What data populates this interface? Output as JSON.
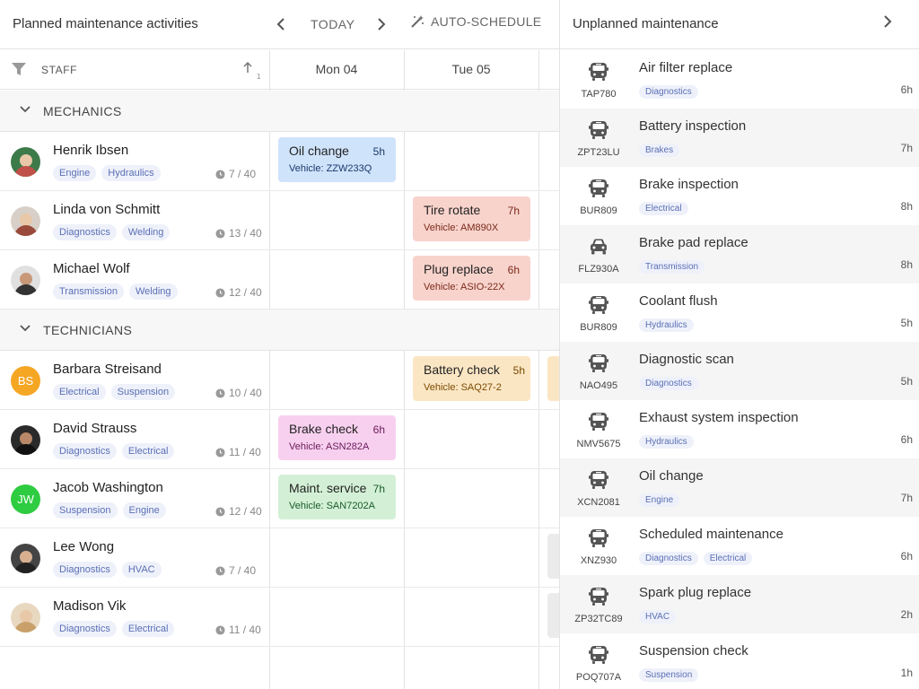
{
  "header": {
    "title": "Planned maintenance activities",
    "today_label": "TODAY",
    "autoschedule_label": "AUTO-SCHEDULE"
  },
  "columns": {
    "staff_label": "STAFF",
    "sort_count": "1",
    "days": [
      "Mon 04",
      "Tue 05"
    ]
  },
  "groups": {
    "mechanics": "MECHANICS",
    "technicians": "TECHNICIANS"
  },
  "staff": [
    {
      "name": "Henrik Ibsen",
      "tags": [
        "Engine",
        "Hydraulics"
      ],
      "hours": "7 / 40",
      "initials": "",
      "avatar_color": "#3d7a4a"
    },
    {
      "name": "Linda von Schmitt",
      "tags": [
        "Diagnostics",
        "Welding"
      ],
      "hours": "13 / 40",
      "initials": "",
      "avatar_color": "#9a4a3a"
    },
    {
      "name": "Michael Wolf",
      "tags": [
        "Transmission",
        "Welding"
      ],
      "hours": "12 / 40",
      "initials": "",
      "avatar_color": "#333333"
    },
    {
      "name": "Barbara Streisand",
      "tags": [
        "Electrical",
        "Suspension"
      ],
      "hours": "10 / 40",
      "initials": "BS",
      "avatar_color": "#f5a623"
    },
    {
      "name": "David Strauss",
      "tags": [
        "Diagnostics",
        "Electrical"
      ],
      "hours": "11 / 40",
      "initials": "",
      "avatar_color": "#2a2a2a"
    },
    {
      "name": "Jacob Washington",
      "tags": [
        "Suspension",
        "Engine"
      ],
      "hours": "12 / 40",
      "initials": "JW",
      "avatar_color": "#2ecc40"
    },
    {
      "name": "Lee Wong",
      "tags": [
        "Diagnostics",
        "HVAC"
      ],
      "hours": "7 / 40",
      "initials": "",
      "avatar_color": "#444444"
    },
    {
      "name": "Madison Vik",
      "tags": [
        "Diagnostics",
        "Electrical"
      ],
      "hours": "11 / 40",
      "initials": "",
      "avatar_color": "#c9a06a"
    }
  ],
  "events": [
    {
      "title": "Oil change",
      "duration": "5h",
      "vehicle": "Vehicle: ZZW233Q",
      "bg": "#cfe3fb",
      "fg": "#1a3a6b"
    },
    {
      "title": "Tire rotate",
      "duration": "7h",
      "vehicle": "Vehicle: AM890X",
      "bg": "#f8d3cc",
      "fg": "#7a2a1a"
    },
    {
      "title": "Plug replace",
      "duration": "6h",
      "vehicle": "Vehicle: ASIO-22X",
      "bg": "#f8d3cc",
      "fg": "#7a2a1a"
    },
    {
      "title": "Battery check",
      "duration": "5h",
      "vehicle": "Vehicle: SAQ27-2",
      "bg": "#fbe6c4",
      "fg": "#7a4a00"
    },
    {
      "title": "Brake check",
      "duration": "6h",
      "vehicle": "Vehicle: ASN282A",
      "bg": "#f8d0ef",
      "fg": "#6a1a5a"
    },
    {
      "title": "Maint. service",
      "duration": "7h",
      "vehicle": "Vehicle: SAN7202A",
      "bg": "#d3f0d6",
      "fg": "#1a5a2a"
    }
  ],
  "unplanned": {
    "title": "Unplanned maintenance",
    "items": [
      {
        "title": "Air filter replace",
        "plate": "TAP780",
        "tags": [
          "Diagnostics"
        ],
        "duration": "6h",
        "icon": "bus-icon"
      },
      {
        "title": "Battery inspection",
        "plate": "ZPT23LU",
        "tags": [
          "Brakes"
        ],
        "duration": "7h",
        "icon": "bus-icon"
      },
      {
        "title": "Brake inspection",
        "plate": "BUR809",
        "tags": [
          "Electrical"
        ],
        "duration": "8h",
        "icon": "bus-icon"
      },
      {
        "title": "Brake pad replace",
        "plate": "FLZ930A",
        "tags": [
          "Transmission"
        ],
        "duration": "8h",
        "icon": "car-icon"
      },
      {
        "title": "Coolant flush",
        "plate": "BUR809",
        "tags": [
          "Hydraulics"
        ],
        "duration": "5h",
        "icon": "bus-icon"
      },
      {
        "title": "Diagnostic scan",
        "plate": "NAO495",
        "tags": [
          "Diagnostics"
        ],
        "duration": "5h",
        "icon": "bus-icon"
      },
      {
        "title": "Exhaust system inspection",
        "plate": "NMV5675",
        "tags": [
          "Hydraulics"
        ],
        "duration": "6h",
        "icon": "bus-icon"
      },
      {
        "title": "Oil change",
        "plate": "XCN2081",
        "tags": [
          "Engine"
        ],
        "duration": "7h",
        "icon": "bus-icon"
      },
      {
        "title": "Scheduled maintenance",
        "plate": "XNZ930",
        "tags": [
          "Diagnostics",
          "Electrical"
        ],
        "duration": "6h",
        "icon": "bus-icon"
      },
      {
        "title": "Spark plug replace",
        "plate": "ZP32TC89",
        "tags": [
          "HVAC"
        ],
        "duration": "2h",
        "icon": "bus-icon"
      },
      {
        "title": "Suspension check",
        "plate": "POQ707A",
        "tags": [
          "Suspension"
        ],
        "duration": "1h",
        "icon": "bus-icon"
      }
    ]
  }
}
